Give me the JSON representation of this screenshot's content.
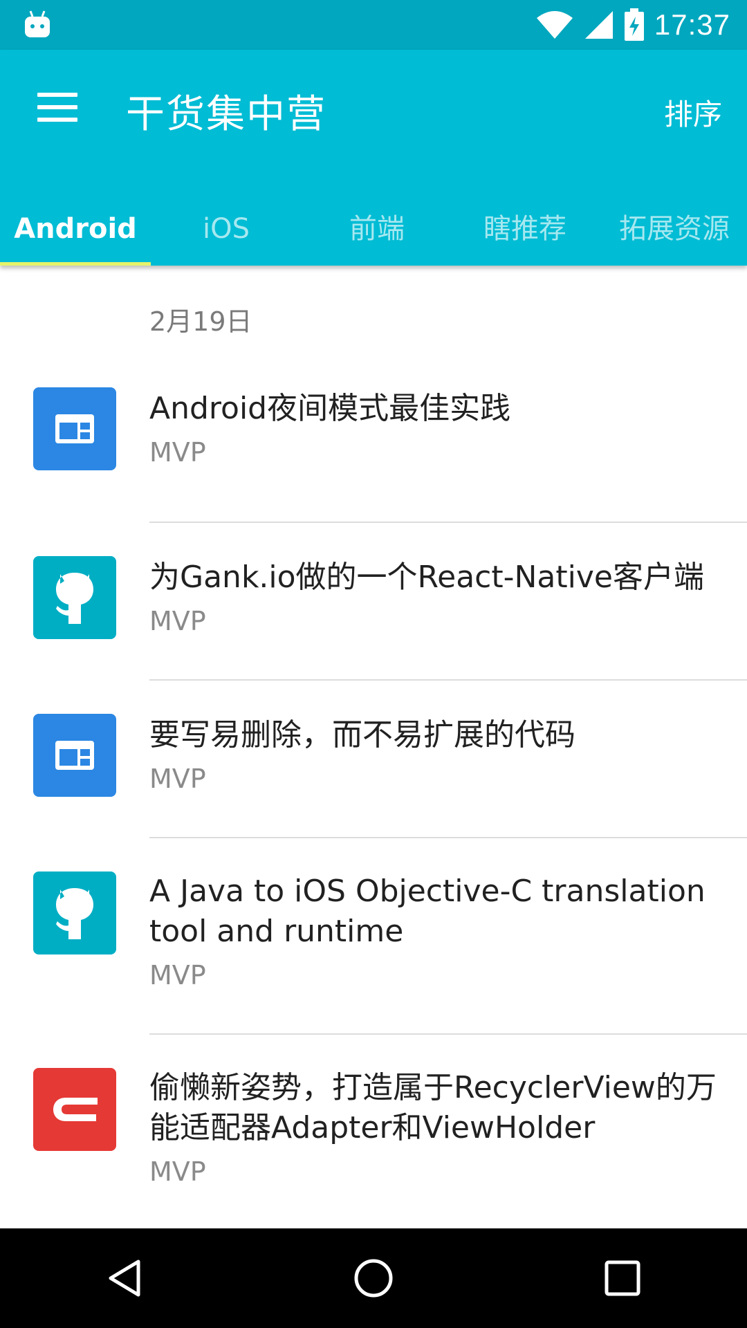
{
  "status_bar": {
    "time": "17:37",
    "battery_icon": "battery-charging-icon",
    "wifi_icon": "wifi-icon",
    "signal_icon": "signal-icon",
    "notification_icon": "android-notification-icon"
  },
  "app_bar": {
    "title": "干货集中营",
    "sort_label": "排序",
    "menu_icon": "menu-icon"
  },
  "tabs": [
    {
      "label": "Android",
      "active": true
    },
    {
      "label": "iOS",
      "active": false
    },
    {
      "label": "前端",
      "active": false
    },
    {
      "label": "瞎推荐",
      "active": false
    },
    {
      "label": "拓展资源",
      "active": false
    }
  ],
  "list": {
    "date": "2月19日",
    "items": [
      {
        "title": "Android夜间模式最佳实践",
        "author": "MVP",
        "icon": "web-page-icon",
        "icon_color": "#2B87E3"
      },
      {
        "title": "为Gank.io做的一个React-Native客户端",
        "author": "MVP",
        "icon": "github-icon",
        "icon_color": "#00AEC4"
      },
      {
        "title": "要写易删除，而不易扩展的代码",
        "author": "MVP",
        "icon": "web-page-icon",
        "icon_color": "#2B87E3"
      },
      {
        "title": "A Java to iOS Objective-C translation tool and runtime",
        "author": "MVP",
        "icon": "github-icon",
        "icon_color": "#00AEC4"
      },
      {
        "title": "偷懒新姿势，打造属于RecyclerView的万能适配器Adapter和ViewHolder",
        "author": "MVP",
        "icon": "csdn-icon",
        "icon_color": "#E53935"
      }
    ]
  },
  "nav_bar": {
    "back_icon": "back-icon",
    "home_icon": "home-icon",
    "recents_icon": "recents-icon"
  },
  "colors": {
    "primary": "#00BCD4",
    "status_bar": "#00A7BE",
    "tab_indicator": "#E6F36A"
  }
}
